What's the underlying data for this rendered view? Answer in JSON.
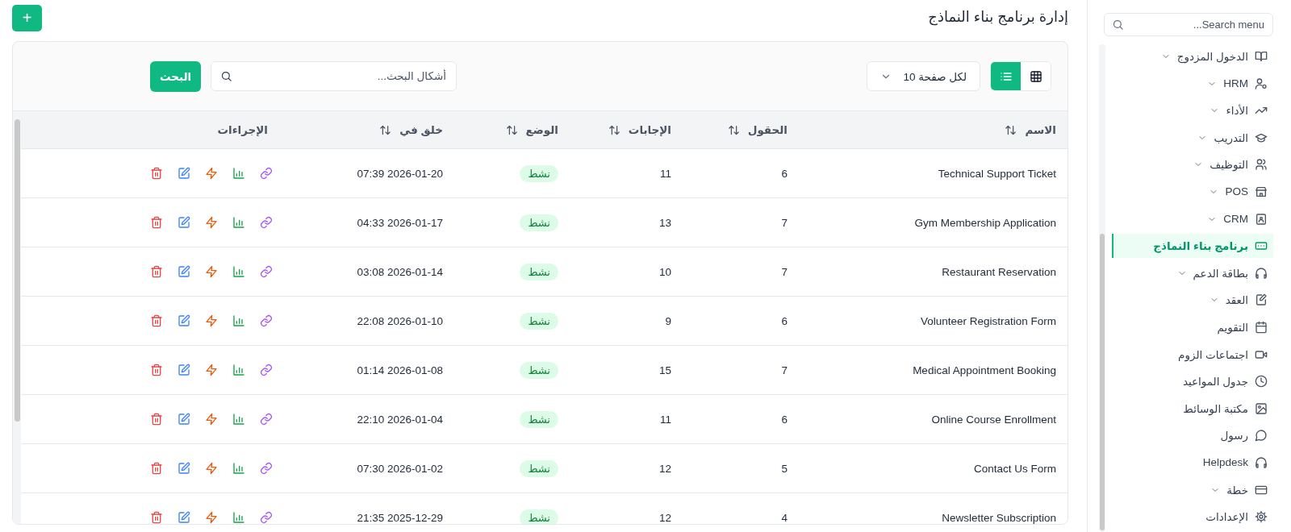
{
  "sidebar": {
    "search": {
      "placeholder": "Search menu..."
    },
    "items": [
      {
        "label": "الدخول المزدوج",
        "expandable": true,
        "selected": false
      },
      {
        "label": "HRM",
        "expandable": true,
        "selected": false
      },
      {
        "label": "الأداء",
        "expandable": true,
        "selected": false
      },
      {
        "label": "التدريب",
        "expandable": true,
        "selected": false
      },
      {
        "label": "التوظيف",
        "expandable": true,
        "selected": false
      },
      {
        "label": "POS",
        "expandable": true,
        "selected": false
      },
      {
        "label": "CRM",
        "expandable": true,
        "selected": false
      },
      {
        "label": "برنامج بناء النماذج",
        "expandable": false,
        "selected": true
      },
      {
        "label": "بطاقة الدعم",
        "expandable": true,
        "selected": false
      },
      {
        "label": "العقد",
        "expandable": true,
        "selected": false
      },
      {
        "label": "التقويم",
        "expandable": false,
        "selected": false
      },
      {
        "label": "اجتماعات الزوم",
        "expandable": false,
        "selected": false
      },
      {
        "label": "جدول المواعيد",
        "expandable": false,
        "selected": false
      },
      {
        "label": "مكتبة الوسائط",
        "expandable": false,
        "selected": false
      },
      {
        "label": "رسول",
        "expandable": false,
        "selected": false
      },
      {
        "label": "Helpdesk",
        "expandable": false,
        "selected": false
      },
      {
        "label": "خطة",
        "expandable": true,
        "selected": false
      },
      {
        "label": "الإعدادات",
        "expandable": false,
        "selected": false
      }
    ]
  },
  "header": {
    "title": "إدارة برنامج بناء النماذج",
    "add_button": "+"
  },
  "toolbar": {
    "view_toggle": [
      {
        "kind": "grid",
        "selected": false
      },
      {
        "kind": "list",
        "selected": true
      }
    ],
    "per_page": "لكل صفحة 10",
    "search": {
      "placeholder": "أشكال البحث..."
    },
    "search_button": "البحث"
  },
  "table": {
    "columns": [
      {
        "label": "الاسم",
        "sortable": true
      },
      {
        "label": "الحقول",
        "sortable": true
      },
      {
        "label": "الإجابات",
        "sortable": true
      },
      {
        "label": "الوضع",
        "sortable": true
      },
      {
        "label": "خلق في",
        "sortable": true
      },
      {
        "label": "الإجراءات",
        "sortable": false
      }
    ],
    "rows": [
      {
        "name": "Technical Support Ticket",
        "fields": "6",
        "responses": "11",
        "status": "نشط",
        "created": "2026-01-20 07:39"
      },
      {
        "name": "Gym Membership Application",
        "fields": "7",
        "responses": "13",
        "status": "نشط",
        "created": "2026-01-17 04:33"
      },
      {
        "name": "Restaurant Reservation",
        "fields": "7",
        "responses": "10",
        "status": "نشط",
        "created": "2026-01-14 03:08"
      },
      {
        "name": "Volunteer Registration Form",
        "fields": "6",
        "responses": "9",
        "status": "نشط",
        "created": "2026-01-10 22:08"
      },
      {
        "name": "Medical Appointment Booking",
        "fields": "7",
        "responses": "15",
        "status": "نشط",
        "created": "2026-01-08 01:14"
      },
      {
        "name": "Online Course Enrollment",
        "fields": "6",
        "responses": "11",
        "status": "نشط",
        "created": "2026-01-04 22:10"
      },
      {
        "name": "Contact Us Form",
        "fields": "5",
        "responses": "12",
        "status": "نشط",
        "created": "2026-01-02 07:30"
      },
      {
        "name": "Newsletter Subscription",
        "fields": "4",
        "responses": "12",
        "status": "نشط",
        "created": "2025-12-29 21:35"
      }
    ]
  }
}
